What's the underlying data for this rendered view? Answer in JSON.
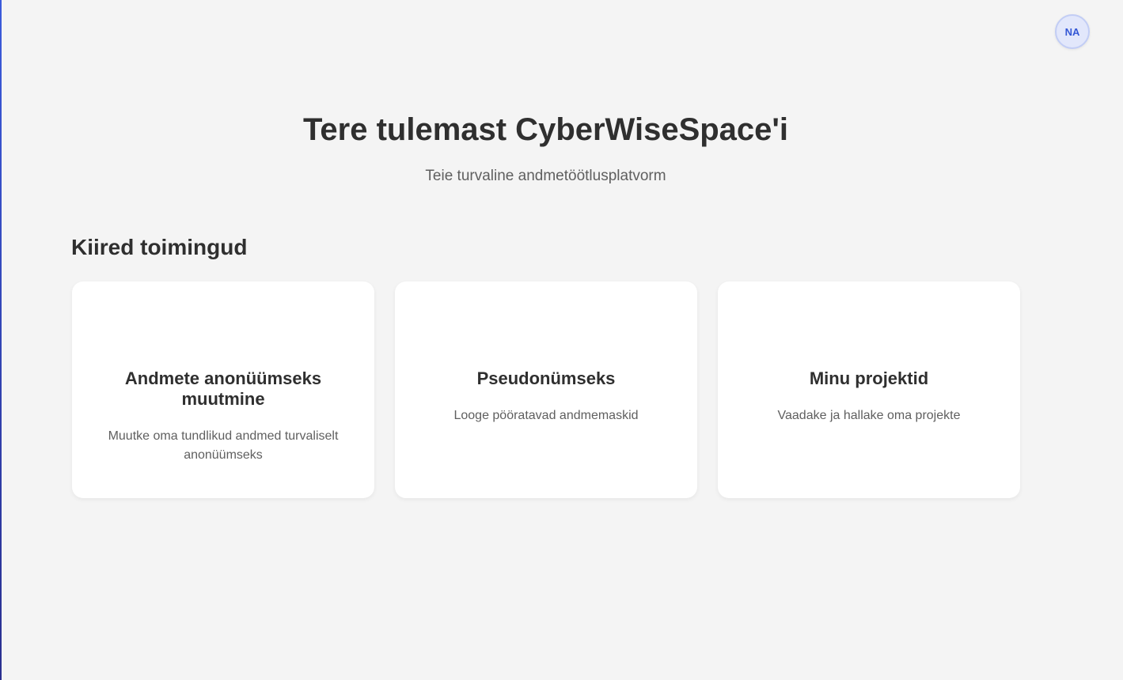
{
  "user": {
    "initials": "NA"
  },
  "hero": {
    "title": "Tere tulemast CyberWiseSpace'i",
    "subtitle": "Teie turvaline andmetöötlusplatvorm"
  },
  "quick_actions": {
    "title": "Kiired toimingud",
    "cards": [
      {
        "title": "Andmete anonüümseks muutmine",
        "description": "Muutke oma tundlikud andmed turvaliselt anonüümseks"
      },
      {
        "title": "Pseudonümseks",
        "description": "Looge pööratavad andmemaskid"
      },
      {
        "title": "Minu projektid",
        "description": "Vaadake ja hallake oma projekte"
      }
    ]
  },
  "colors": {
    "background": "#f4f4f4",
    "accent": "#3457d5",
    "card": "#ffffff"
  }
}
